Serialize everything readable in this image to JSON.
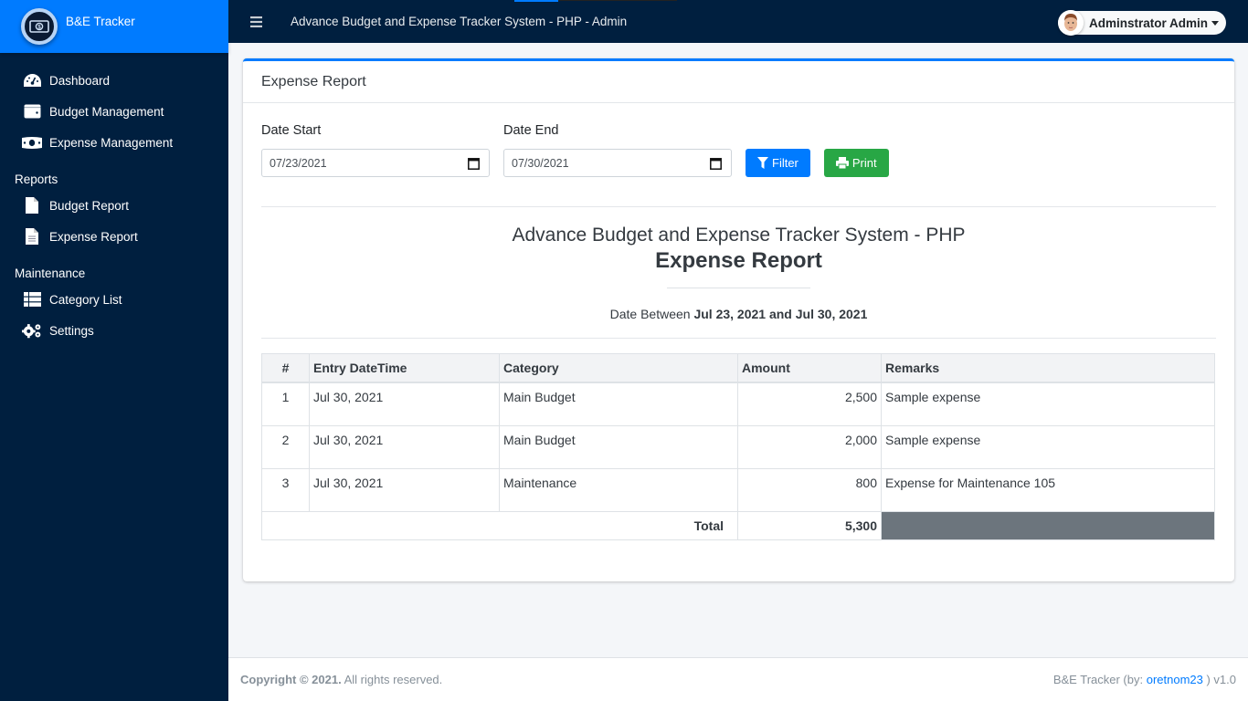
{
  "brand": {
    "name": "B&E Tracker"
  },
  "sidebar": {
    "items": [
      {
        "label": "Dashboard",
        "icon": "tachometer-icon"
      },
      {
        "label": "Budget Management",
        "icon": "wallet-icon"
      },
      {
        "label": "Expense Management",
        "icon": "money-bill-icon"
      }
    ],
    "reports_header": "Reports",
    "reports": [
      {
        "label": "Budget Report",
        "icon": "file-icon"
      },
      {
        "label": "Expense Report",
        "icon": "file-alt-icon"
      }
    ],
    "maintenance_header": "Maintenance",
    "maintenance": [
      {
        "label": "Category List",
        "icon": "th-list-icon"
      },
      {
        "label": "Settings",
        "icon": "cogs-icon"
      }
    ]
  },
  "topnav": {
    "title": "Advance Budget and Expense Tracker System - PHP - Admin",
    "user": "Adminstrator Admin"
  },
  "card": {
    "title": "Expense Report",
    "filters": {
      "date_start_label": "Date Start",
      "date_start_value": "07/23/2021",
      "date_end_label": "Date End",
      "date_end_value": "07/30/2021",
      "filter_label": "Filter",
      "print_label": "Print"
    },
    "report": {
      "system_title": "Advance Budget and Expense Tracker System - PHP",
      "report_title": "Expense Report",
      "date_prefix": "Date Between",
      "date_from": "Jul 23, 2021",
      "date_and": "and",
      "date_to": "Jul 30, 2021"
    },
    "table": {
      "headers": [
        "#",
        "Entry DateTime",
        "Category",
        "Amount",
        "Remarks"
      ],
      "rows": [
        {
          "num": "1",
          "date": "Jul 30, 2021",
          "category": "Main Budget",
          "amount": "2,500",
          "remarks": "Sample expense"
        },
        {
          "num": "2",
          "date": "Jul 30, 2021",
          "category": "Main Budget",
          "amount": "2,000",
          "remarks": "Sample expense"
        },
        {
          "num": "3",
          "date": "Jul 30, 2021",
          "category": "Maintenance",
          "amount": "800",
          "remarks": "Expense for Maintenance 105"
        }
      ],
      "total_label": "Total",
      "total_value": "5,300"
    }
  },
  "footer": {
    "copyright": "Copyright © 2021.",
    "rights": " All rights reserved.",
    "app": "B&E Tracker (by: ",
    "author": "oretnom23",
    "version": " ) v1.0"
  }
}
